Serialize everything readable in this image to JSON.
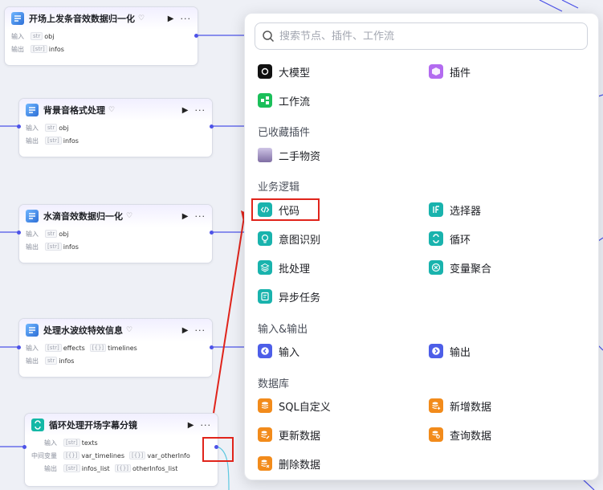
{
  "nodes": [
    {
      "title": "开场上发条音效数据归一化",
      "inputs": [
        {
          "type": "str",
          "name": "obj"
        }
      ],
      "outputs": [
        {
          "type": "[str]",
          "name": "infos"
        }
      ]
    },
    {
      "title": "背景音格式处理",
      "inputs": [
        {
          "type": "str",
          "name": "obj"
        }
      ],
      "outputs": [
        {
          "type": "[str]",
          "name": "infos"
        }
      ]
    },
    {
      "title": "水滴音效数据归一化",
      "inputs": [
        {
          "type": "str",
          "name": "obj"
        }
      ],
      "outputs": [
        {
          "type": "[str]",
          "name": "infos"
        }
      ]
    },
    {
      "title": "处理水波纹特效信息",
      "inputs": [
        {
          "type": "[str]",
          "name": "effects"
        },
        {
          "type": "[{}]",
          "name": "timelines"
        }
      ],
      "outputs": [
        {
          "type": "str",
          "name": "infos"
        }
      ]
    }
  ],
  "loop_node": {
    "title": "循环处理开场字幕分镜",
    "input_label": "输入",
    "mid_label": "中间变量",
    "output_label": "输出",
    "inputs": [
      {
        "type": "[str]",
        "name": "texts"
      }
    ],
    "vars": [
      {
        "type": "[{}]",
        "name": "var_timelines"
      },
      {
        "type": "[{}]",
        "name": "var_otherInfo"
      }
    ],
    "outputs": [
      {
        "type": "[str]",
        "name": "infos_list"
      },
      {
        "type": "[{}]",
        "name": "otherInfos_list"
      }
    ]
  },
  "labels": {
    "input": "输入",
    "output": "输出",
    "run": "▶",
    "more": "···",
    "badge": "♡"
  },
  "panel": {
    "search_placeholder": "搜索节点、插件、工作流",
    "top_items": [
      {
        "label": "大模型",
        "icon": "llm-icon"
      },
      {
        "label": "插件",
        "icon": "plugin-icon"
      },
      {
        "label": "工作流",
        "icon": "workflow-icon"
      }
    ],
    "sections": [
      {
        "title": "已收藏插件",
        "items": [
          {
            "label": "二手物资",
            "icon": "avatar-icon"
          }
        ]
      },
      {
        "title": "业务逻辑",
        "items": [
          {
            "label": "代码",
            "icon": "code-icon"
          },
          {
            "label": "选择器",
            "icon": "if-icon"
          },
          {
            "label": "意图识别",
            "icon": "intent-icon"
          },
          {
            "label": "循环",
            "icon": "loop-icon"
          },
          {
            "label": "批处理",
            "icon": "batch-icon"
          },
          {
            "label": "变量聚合",
            "icon": "aggregate-icon"
          },
          {
            "label": "异步任务",
            "icon": "async-icon"
          }
        ]
      },
      {
        "title": "输入&输出",
        "items": [
          {
            "label": "输入",
            "icon": "input-icon"
          },
          {
            "label": "输出",
            "icon": "output-icon"
          }
        ]
      },
      {
        "title": "数据库",
        "items": [
          {
            "label": "SQL自定义",
            "icon": "sql-icon"
          },
          {
            "label": "新增数据",
            "icon": "db-add-icon"
          },
          {
            "label": "更新数据",
            "icon": "db-update-icon"
          },
          {
            "label": "查询数据",
            "icon": "db-query-icon"
          },
          {
            "label": "删除数据",
            "icon": "db-delete-icon"
          }
        ]
      }
    ]
  },
  "colors": {
    "accent": "#4d53e8",
    "highlight": "#e0241b",
    "teal": "#19b3ad",
    "orange": "#f28b1b"
  }
}
